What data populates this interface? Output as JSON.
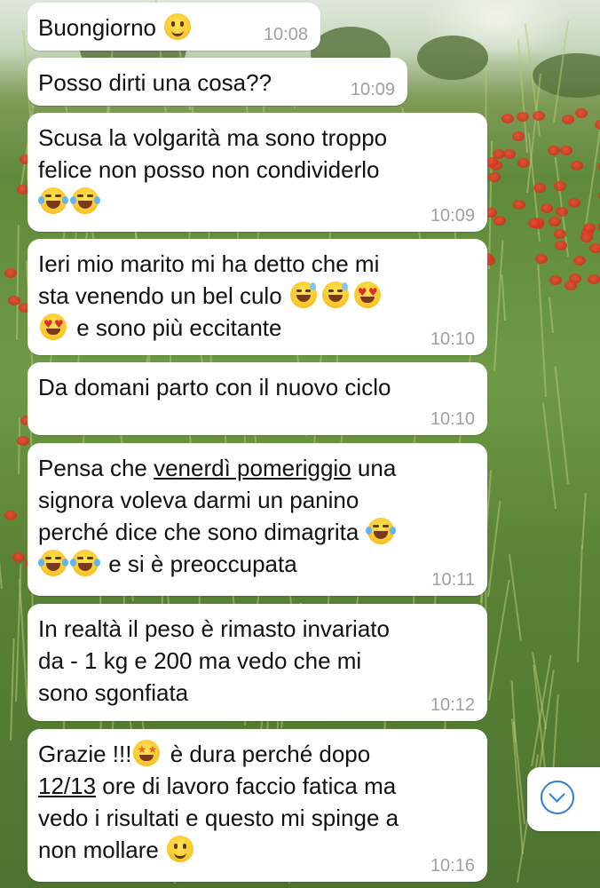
{
  "messages": [
    {
      "parts": [
        {
          "t": "Buongiorno "
        },
        {
          "e": "smile"
        }
      ],
      "time": "10:08"
    },
    {
      "parts": [
        {
          "t": "Posso dirti una cosa??"
        }
      ],
      "time": "10:09"
    },
    {
      "parts": [
        {
          "t": "Scusa la volgarità ma sono troppo\nfelice non posso non condividerlo\n"
        },
        {
          "e": "joy"
        },
        {
          "e": "joy"
        }
      ],
      "time": "10:09"
    },
    {
      "parts": [
        {
          "t": "Ieri mio marito mi ha detto che mi\nsta venendo un bel culo "
        },
        {
          "e": "sweat"
        },
        {
          "e": "sweat"
        },
        {
          "e": "heart"
        },
        {
          "t": "\n"
        },
        {
          "e": "heart"
        },
        {
          "t": " e sono più eccitante"
        }
      ],
      "time": "10:10"
    },
    {
      "parts": [
        {
          "t": "Da domani parto con il nuovo ciclo"
        }
      ],
      "time": "10:10"
    },
    {
      "parts": [
        {
          "t": "Pensa che "
        },
        {
          "u": "venerdì pomeriggio"
        },
        {
          "t": " una\nsignora voleva darmi un panino\nperché dice che sono dimagrita "
        },
        {
          "e": "joy"
        },
        {
          "t": "\n"
        },
        {
          "e": "joy"
        },
        {
          "e": "joy"
        },
        {
          "t": " e si è preoccupata"
        }
      ],
      "time": "10:11"
    },
    {
      "parts": [
        {
          "t": "In realtà il peso è rimasto invariato\nda - 1 kg e 200 ma vedo che mi\nsono sgonfiata"
        }
      ],
      "time": "10:12"
    },
    {
      "parts": [
        {
          "t": "Grazie !!!"
        },
        {
          "e": "star"
        },
        {
          "t": " è dura perché dopo\n"
        },
        {
          "u": "12/13"
        },
        {
          "t": " ore di lavoro faccio fatica ma\nvedo i risultati e questo mi spinge a\nnon mollare "
        },
        {
          "e": "smile"
        }
      ],
      "time": "10:16"
    }
  ],
  "scroll_button": {
    "icon": "chevron-down-circle-icon",
    "color": "#2f7ddb"
  }
}
